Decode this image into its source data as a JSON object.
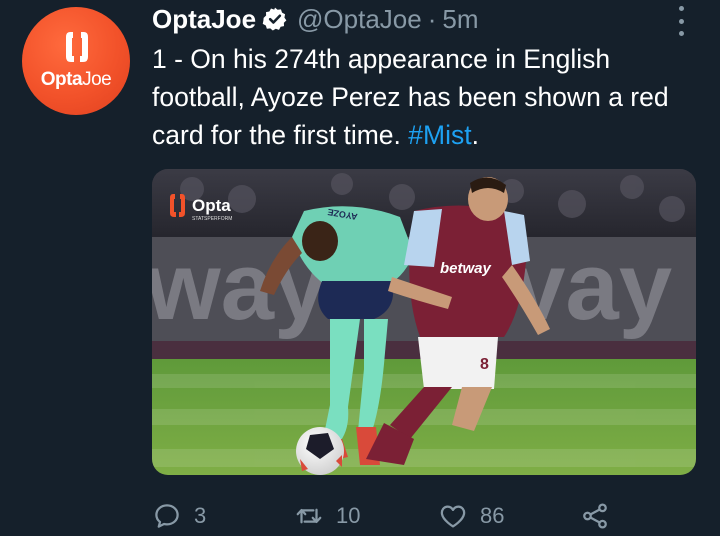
{
  "author": {
    "display_name": "OptaJoe",
    "handle": "@OptaJoe",
    "separator": "·",
    "time": "5m",
    "avatar_text_bold": "Opta",
    "avatar_text_light": "Joe",
    "verified": true
  },
  "tweet": {
    "text": "1 - On his 274th appearance in English football, Ayoze Perez has been shown a red card for the first time.",
    "hashtag": "#Mist",
    "trailing": "."
  },
  "media": {
    "watermark": "Opta",
    "watermark_sub": "STATSPERFORM",
    "sponsor": "betway",
    "shirt_number": "8",
    "shirt_name": "AYOZE"
  },
  "actions": {
    "reply_count": "3",
    "retweet_count": "10",
    "like_count": "86"
  },
  "colors": {
    "background": "#15202b",
    "muted": "#8899a6",
    "link": "#1da1f2",
    "brand": "#f2522a"
  },
  "icons": [
    "verified-icon",
    "more-icon",
    "reply-icon",
    "retweet-icon",
    "like-icon",
    "share-icon"
  ]
}
